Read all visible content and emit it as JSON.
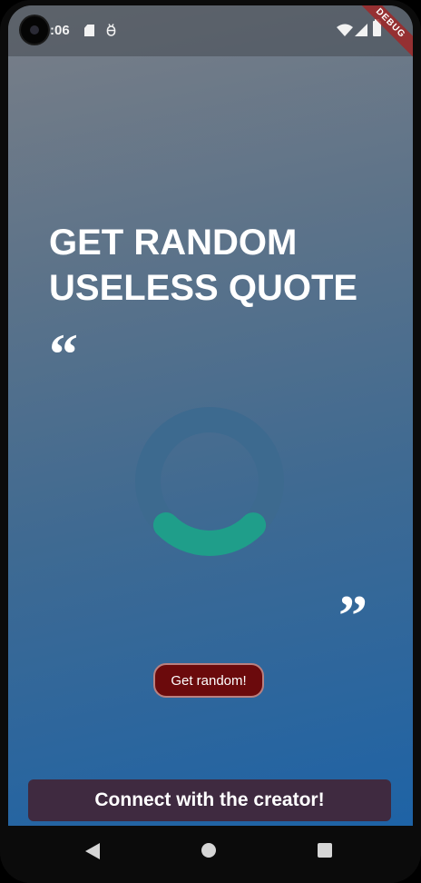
{
  "status_bar": {
    "time": ":06",
    "icons": [
      "camera-icon",
      "sd-card-icon",
      "bug-icon",
      "wifi-icon",
      "signal-icon",
      "battery-icon"
    ],
    "debug_banner": "DEBUG"
  },
  "main": {
    "title_line1": "GET RANDOM",
    "title_line2": "USELESS QUOTE",
    "quote_open": "“",
    "quote_close": "”",
    "loading_progress": 0.25,
    "get_random_label": "Get random!",
    "connect_label": "Connect with the creator!"
  },
  "nav_bar": {
    "icons": [
      "back-icon",
      "home-icon",
      "recents-icon"
    ]
  },
  "colors": {
    "spinner_track": "#3d6a8f",
    "spinner_arc": "#1f9e8a",
    "get_random_bg": "#6b0a0c",
    "connect_bg": "#3f2a40"
  }
}
